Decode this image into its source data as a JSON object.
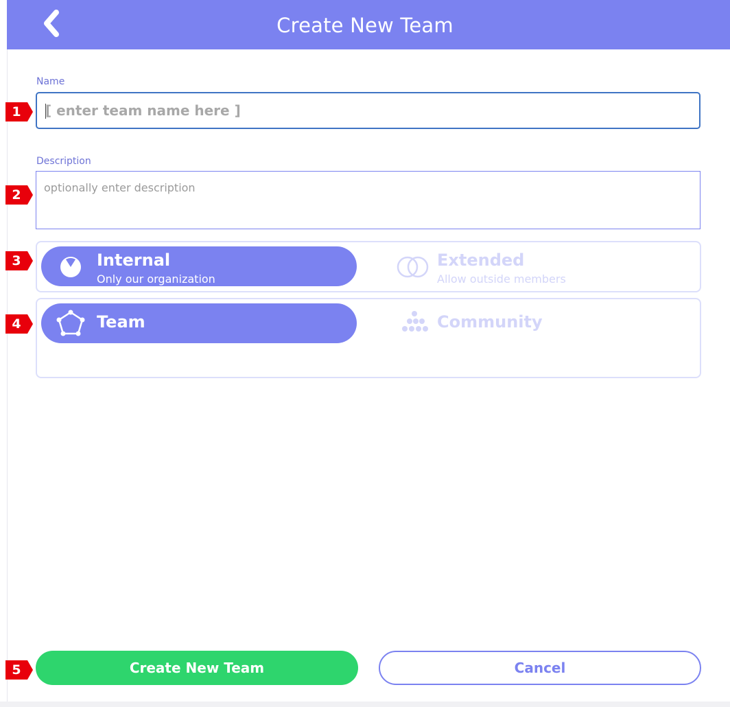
{
  "header": {
    "title": "Create New Team",
    "background": "#7b82f0"
  },
  "form": {
    "name": {
      "label": "Name",
      "placeholder": "[ enter team name here ]",
      "value": ""
    },
    "description": {
      "label": "Description",
      "placeholder": "optionally enter description",
      "value": ""
    },
    "access_toggle": {
      "selected": "internal",
      "options": [
        {
          "id": "internal",
          "title": "Internal",
          "subtitle": "Only our organization",
          "icon": "pie-chart-icon"
        },
        {
          "id": "extended",
          "title": "Extended",
          "subtitle": "Allow outside members",
          "icon": "overlapping-circles-icon"
        }
      ]
    },
    "type_toggle": {
      "selected": "team",
      "options": [
        {
          "id": "team",
          "title": "Team",
          "icon": "pentagon-nodes-icon"
        },
        {
          "id": "community",
          "title": "Community",
          "icon": "dots-cluster-icon"
        }
      ]
    }
  },
  "actions": {
    "create_label": "Create New Team",
    "cancel_label": "Cancel"
  },
  "markers": [
    "1",
    "2",
    "3",
    "4",
    "5"
  ],
  "colors": {
    "accent": "#7b82f0",
    "create_button": "#2ed56d",
    "inactive_text": "#d3d5f9",
    "marker": "#e8000b",
    "focus_border": "#3f74c4"
  }
}
